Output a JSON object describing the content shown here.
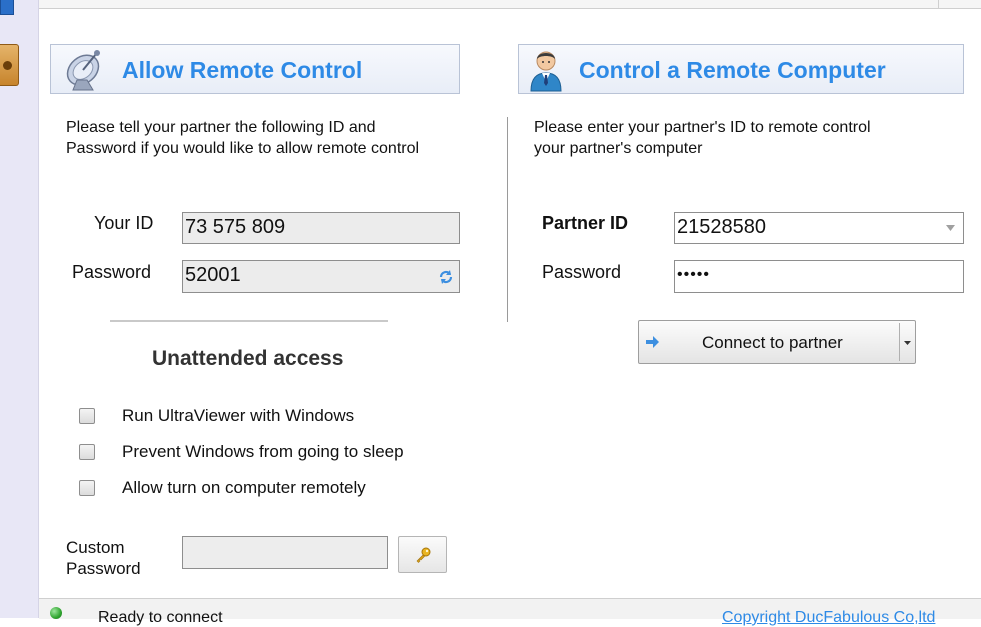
{
  "allow": {
    "title": "Allow Remote Control",
    "description_line1": "Please tell your partner the following ID and",
    "description_line2": "Password if you would like to allow remote control",
    "your_id_label": "Your ID",
    "your_id_value": "73 575 809",
    "password_label": "Password",
    "password_value": "52001"
  },
  "unattended": {
    "title": "Unattended access",
    "options": [
      {
        "label": "Run UltraViewer with Windows",
        "checked": false
      },
      {
        "label": "Prevent Windows from going to sleep",
        "checked": false
      },
      {
        "label": "Allow turn on computer remotely",
        "checked": false
      }
    ],
    "custom_password_label_line1": "Custom",
    "custom_password_label_line2": "Password",
    "custom_password_value": ""
  },
  "control": {
    "title": "Control a Remote Computer",
    "description_line1": "Please enter your partner's ID to remote control",
    "description_line2": "your partner's computer",
    "partner_id_label": "Partner ID",
    "partner_id_value": "21528580",
    "password_label": "Password",
    "password_value": "•••••",
    "connect_label": "Connect to partner"
  },
  "status": {
    "text": "Ready to connect",
    "copyright": "Copyright DucFabulous Co,ltd",
    "indicator_color": "#2fa52f"
  },
  "colors": {
    "accent": "#2e8ae6",
    "header_border": "#b9c3d6"
  },
  "icons": {
    "allow_header": "satellite-dish-icon",
    "control_header": "user-icon",
    "refresh": "refresh-icon",
    "key": "key-icon",
    "connect_arrow": "arrow-right-icon",
    "dropdown": "chevron-down-icon"
  }
}
